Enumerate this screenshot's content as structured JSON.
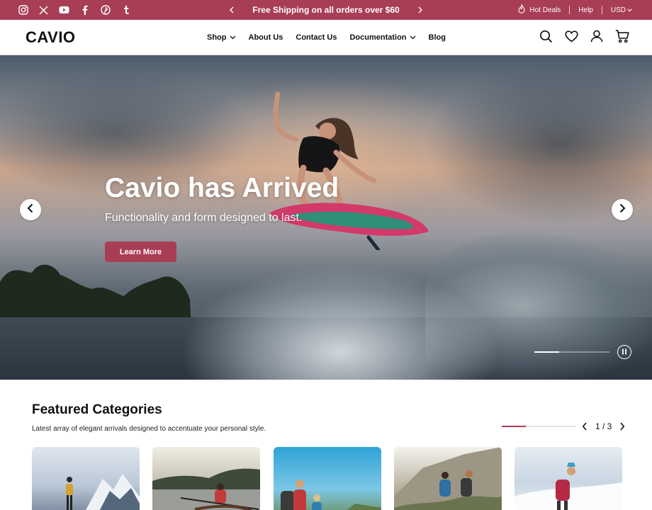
{
  "colors": {
    "brand": "#a83e55",
    "ink": "#111111"
  },
  "topbar": {
    "social_icons": [
      "instagram-icon",
      "x-icon",
      "youtube-icon",
      "facebook-icon",
      "pinterest-icon",
      "tumblr-icon"
    ],
    "promo_text": "Free Shipping on all orders over $60",
    "hot_deals": "Hot Deals",
    "help": "Help",
    "currency": "USD"
  },
  "header": {
    "logo": "CAVIO",
    "nav": [
      {
        "label": "Shop",
        "has_dropdown": true
      },
      {
        "label": "About Us",
        "has_dropdown": false
      },
      {
        "label": "Contact Us",
        "has_dropdown": false
      },
      {
        "label": "Documentation",
        "has_dropdown": true
      },
      {
        "label": "Blog",
        "has_dropdown": false
      }
    ],
    "icons": [
      "search-icon",
      "heart-icon",
      "user-icon",
      "cart-icon"
    ]
  },
  "hero": {
    "title": "Cavio has Arrived",
    "subtitle": "Functionality and form designed to last.",
    "cta": "Learn More",
    "slide_progress": 0.33
  },
  "featured": {
    "title": "Featured Categories",
    "subtitle": "Latest array of elegant arrivals designed to accentuate your personal style.",
    "pager": "1 / 3",
    "progress": 0.33
  }
}
